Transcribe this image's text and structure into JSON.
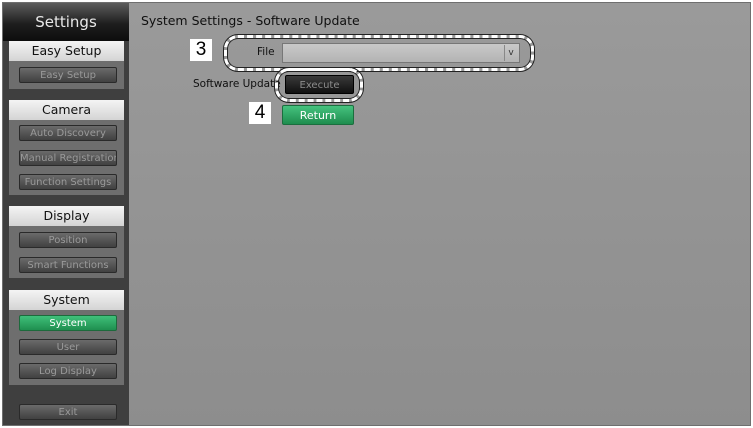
{
  "sidebar": {
    "title": "Settings",
    "sections": [
      {
        "header": "Easy Setup",
        "items": [
          "Easy Setup"
        ]
      },
      {
        "header": "Camera",
        "items": [
          "Auto Discovery",
          "Manual Registration",
          "Function Settings"
        ]
      },
      {
        "header": "Display",
        "items": [
          "Position",
          "Smart Functions"
        ]
      },
      {
        "header": "System",
        "items": [
          "System",
          "User",
          "Log Display"
        ]
      }
    ],
    "exit_label": "Exit"
  },
  "main": {
    "title": "System Settings - Software Update",
    "file_label": "File",
    "file_value": "",
    "software_update_label": "Software Update",
    "execute_label": "Execute",
    "return_label": "Return"
  },
  "callouts": {
    "first": "3",
    "second": "4"
  },
  "colors": {
    "active_green": "#2ea864",
    "sidebar_bg": "#3f3f3f",
    "main_bg": "#939393"
  }
}
